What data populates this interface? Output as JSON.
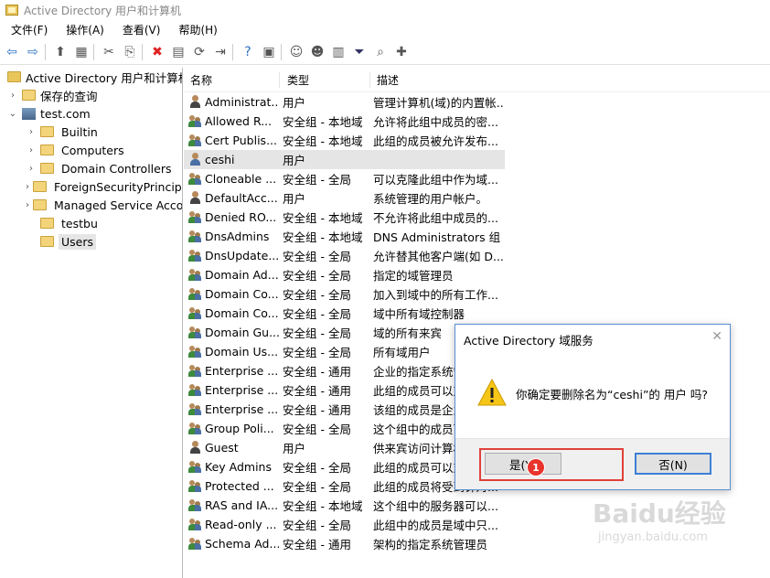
{
  "window": {
    "title": "Active Directory 用户和计算机"
  },
  "menu": [
    "文件(F)",
    "操作(A)",
    "查看(V)",
    "帮助(H)"
  ],
  "toolbar": [
    "back-icon",
    "forward-icon",
    "sep",
    "up-icon",
    "show-tree-icon",
    "sep",
    "cut-icon",
    "copy-icon",
    "sep",
    "delete-icon",
    "properties-icon",
    "refresh-icon",
    "export-icon",
    "sep",
    "help-icon",
    "console-icon",
    "sep",
    "new-user-icon",
    "new-group-icon",
    "new-ou-icon",
    "filter-icon",
    "find-icon",
    "add-to-group-icon"
  ],
  "tree": {
    "root": "Active Directory 用户和计算机",
    "saved_queries": "保存的查询",
    "domain": "test.com",
    "children": [
      "Builtin",
      "Computers",
      "Domain Controllers",
      "ForeignSecurityPrincipals",
      "Managed Service Accounts",
      "testbu",
      "Users"
    ],
    "selected": "Users"
  },
  "list": {
    "headers": {
      "name": "名称",
      "type": "类型",
      "desc": "描述"
    },
    "rows": [
      {
        "icon": "admin",
        "name": "Administrat...",
        "type": "用户",
        "desc": "管理计算机(域)的内置帐..."
      },
      {
        "icon": "group",
        "name": "Allowed R...",
        "type": "安全组 - 本地域",
        "desc": "允许将此组中成员的密..."
      },
      {
        "icon": "group",
        "name": "Cert Publis...",
        "type": "安全组 - 本地域",
        "desc": "此组的成员被允许发布..."
      },
      {
        "icon": "user",
        "name": "ceshi",
        "type": "用户",
        "desc": ""
      },
      {
        "icon": "group",
        "name": "Cloneable ...",
        "type": "安全组 - 全局",
        "desc": "可以克隆此组中作为域..."
      },
      {
        "icon": "admin",
        "name": "DefaultAcc...",
        "type": "用户",
        "desc": "系统管理的用户帐户。"
      },
      {
        "icon": "group",
        "name": "Denied RO...",
        "type": "安全组 - 本地域",
        "desc": "不允许将此组中成员的..."
      },
      {
        "icon": "group",
        "name": "DnsAdmins",
        "type": "安全组 - 本地域",
        "desc": "DNS Administrators 组"
      },
      {
        "icon": "group",
        "name": "DnsUpdate...",
        "type": "安全组 - 全局",
        "desc": "允许替其他客户端(如 D..."
      },
      {
        "icon": "group",
        "name": "Domain Ad...",
        "type": "安全组 - 全局",
        "desc": "指定的域管理员"
      },
      {
        "icon": "group",
        "name": "Domain Co...",
        "type": "安全组 - 全局",
        "desc": "加入到域中的所有工作..."
      },
      {
        "icon": "group",
        "name": "Domain Co...",
        "type": "安全组 - 全局",
        "desc": "域中所有域控制器"
      },
      {
        "icon": "group",
        "name": "Domain Gu...",
        "type": "安全组 - 全局",
        "desc": "域的所有来宾"
      },
      {
        "icon": "group",
        "name": "Domain Us...",
        "type": "安全组 - 全局",
        "desc": "所有域用户"
      },
      {
        "icon": "group",
        "name": "Enterprise ...",
        "type": "安全组 - 通用",
        "desc": "企业的指定系统管"
      },
      {
        "icon": "group",
        "name": "Enterprise ...",
        "type": "安全组 - 通用",
        "desc": "此组的成员可以对"
      },
      {
        "icon": "group",
        "name": "Enterprise ...",
        "type": "安全组 - 通用",
        "desc": "该组的成员是企业"
      },
      {
        "icon": "group",
        "name": "Group Poli...",
        "type": "安全组 - 全局",
        "desc": "这个组中的成员可"
      },
      {
        "icon": "admin",
        "name": "Guest",
        "type": "用户",
        "desc": "供来宾访问计算机"
      },
      {
        "icon": "group",
        "name": "Key Admins",
        "type": "安全组 - 全局",
        "desc": "此组的成员可以对"
      },
      {
        "icon": "group",
        "name": "Protected ...",
        "type": "安全组 - 全局",
        "desc": "此组的成员将受到针对..."
      },
      {
        "icon": "group",
        "name": "RAS and IA...",
        "type": "安全组 - 本地域",
        "desc": "这个组中的服务器可以..."
      },
      {
        "icon": "group",
        "name": "Read-only ...",
        "type": "安全组 - 全局",
        "desc": "此组中的成员是域中只..."
      },
      {
        "icon": "group",
        "name": "Schema Ad...",
        "type": "安全组 - 通用",
        "desc": "架构的指定系统管理员"
      }
    ],
    "selected_index": 3
  },
  "dialog": {
    "title": "Active Directory 域服务",
    "message": "你确定要删除名为“ceshi”的 用户 吗?",
    "yes_label": "是(Y)",
    "no_label": "否(N)",
    "step_badge": "1"
  },
  "watermark": {
    "logo": "Baidu经验",
    "url": "jingyan.baidu.com"
  },
  "colors": {
    "accent_border": "#5b8fd1",
    "highlight": "#e0403a",
    "warning": "#f5c518"
  }
}
